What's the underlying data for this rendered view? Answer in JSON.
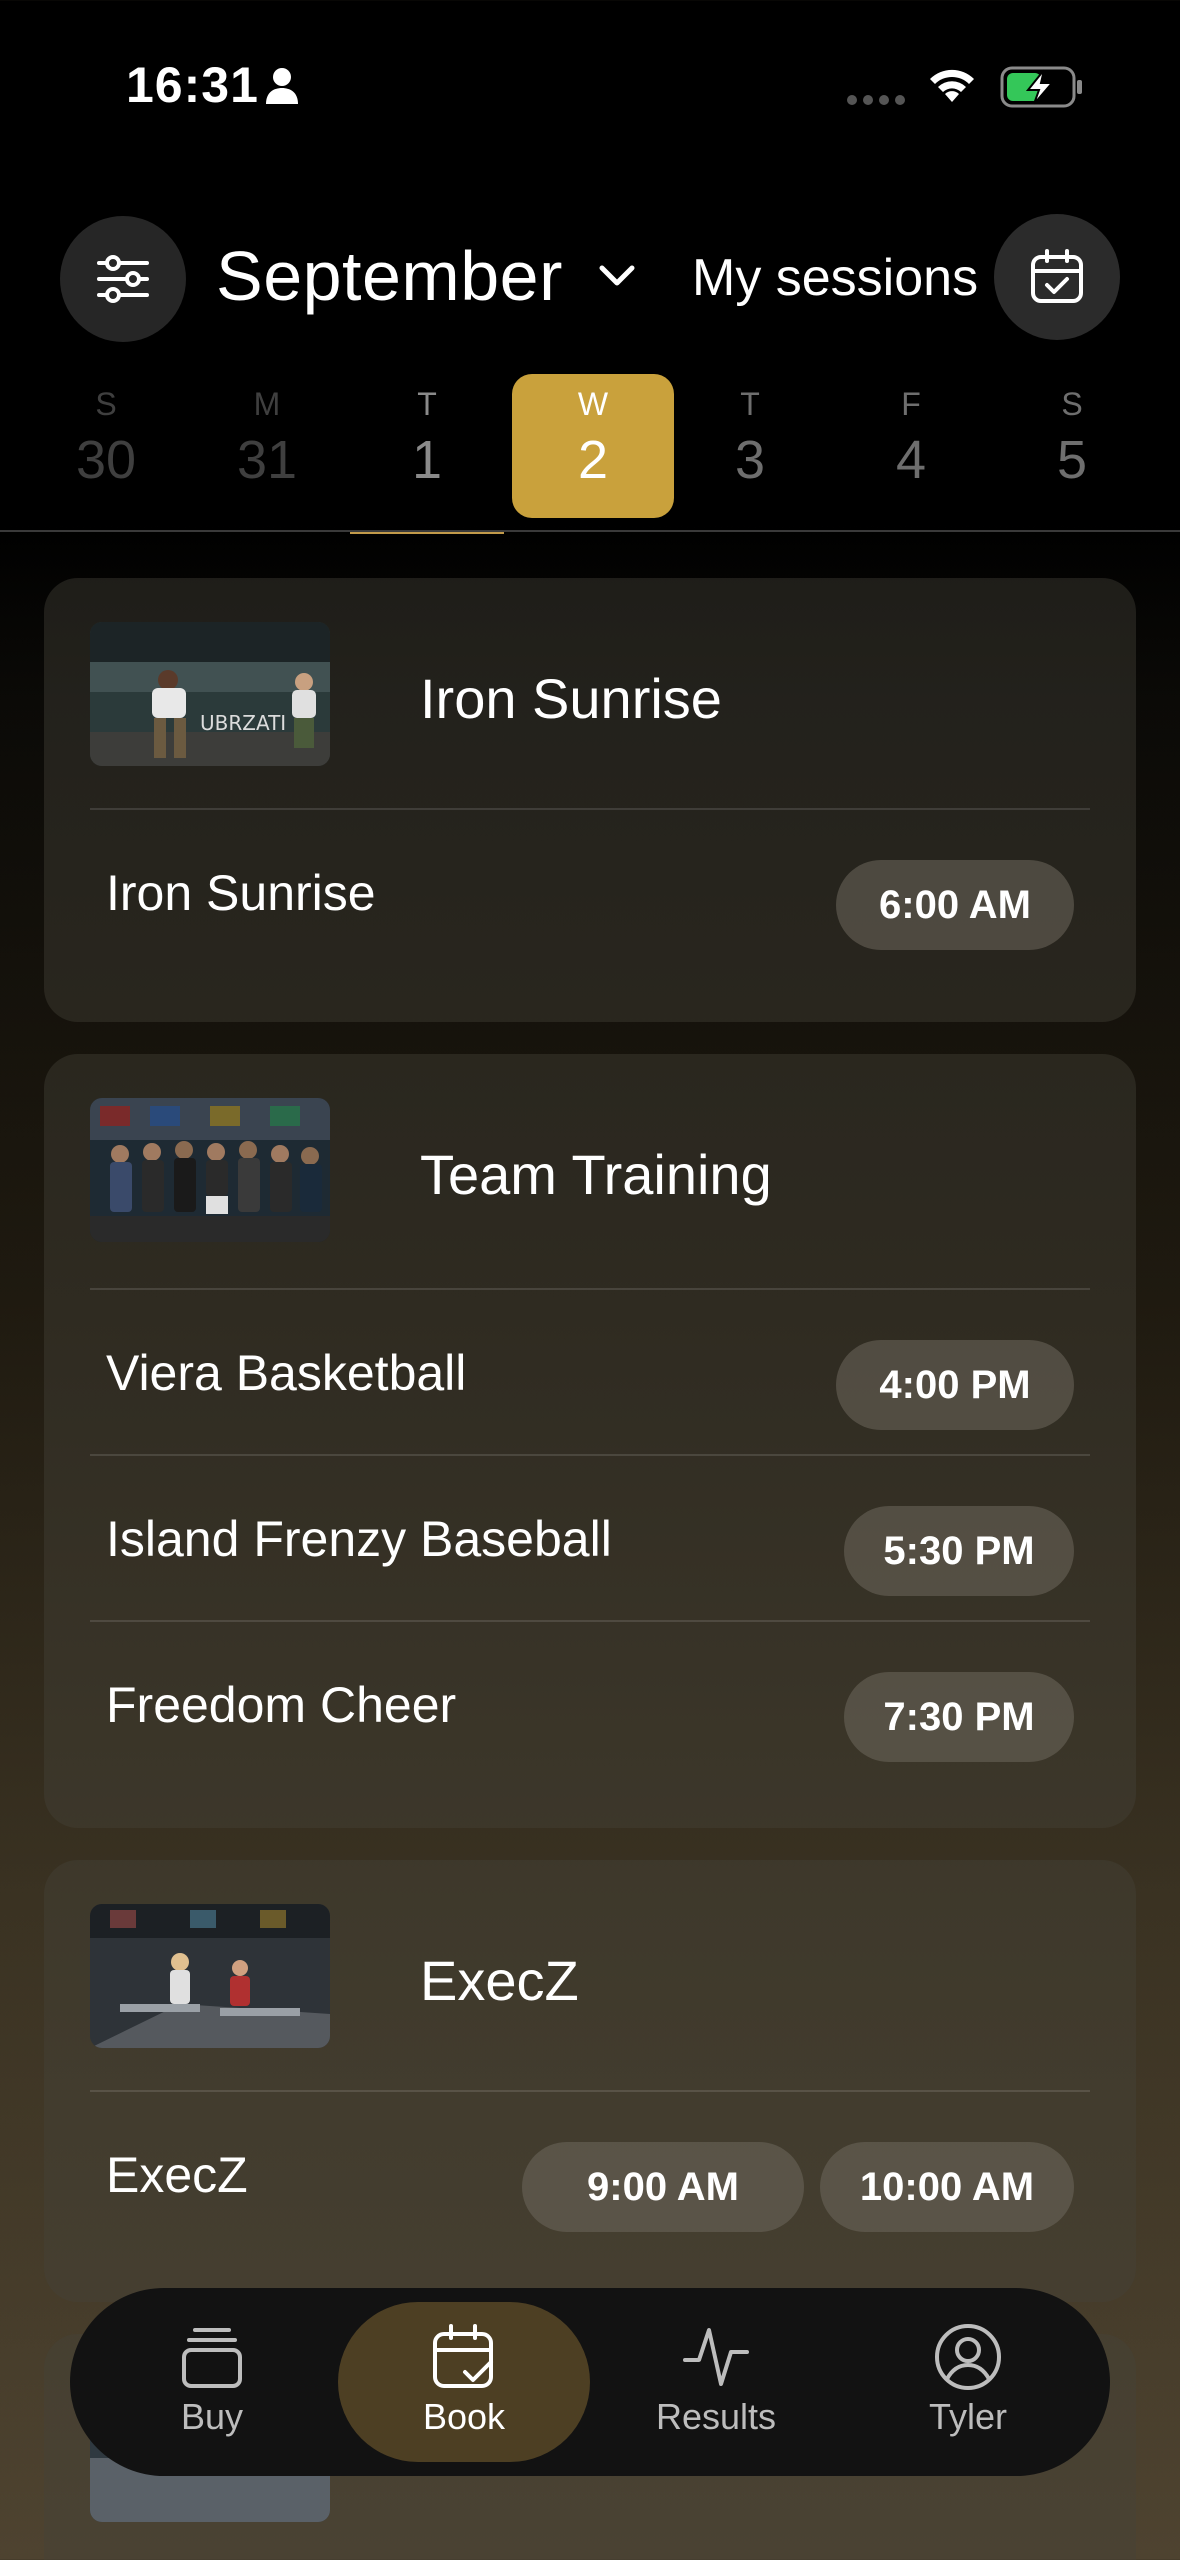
{
  "status_bar": {
    "time": "16:31",
    "icons": [
      "person-icon",
      "signal-dots-icon",
      "wifi-icon",
      "battery-charging-icon"
    ]
  },
  "header": {
    "filter_icon": "sliders-icon",
    "month": "September",
    "month_chevron": "chevron-down-icon",
    "my_sessions": "My sessions",
    "calendar_icon": "calendar-check-icon"
  },
  "days": [
    {
      "letter": "S",
      "number": "30"
    },
    {
      "letter": "M",
      "number": "31"
    },
    {
      "letter": "T",
      "number": "1"
    },
    {
      "letter": "W",
      "number": "2"
    },
    {
      "letter": "T",
      "number": "3"
    },
    {
      "letter": "F",
      "number": "4"
    },
    {
      "letter": "S",
      "number": "5"
    }
  ],
  "selected_day": "2",
  "cards": [
    {
      "title": "Iron Sunrise",
      "rows": [
        {
          "label": "Iron Sunrise",
          "times": [
            "6:00 AM"
          ]
        }
      ]
    },
    {
      "title": "Team Training",
      "rows": [
        {
          "label": "Viera Basketball",
          "times": [
            "4:00 PM"
          ]
        },
        {
          "label": "Island Frenzy Baseball",
          "times": [
            "5:30 PM"
          ]
        },
        {
          "label": "Freedom Cheer",
          "times": [
            "7:30 PM"
          ]
        }
      ]
    },
    {
      "title": "ExecZ",
      "rows": [
        {
          "label": "ExecZ",
          "times": [
            "9:00 AM",
            "10:00 AM"
          ]
        }
      ]
    }
  ],
  "tabbar": {
    "tabs": [
      {
        "label": "Buy",
        "icon": "stack-icon"
      },
      {
        "label": "Book",
        "icon": "calendar-check-icon"
      },
      {
        "label": "Results",
        "icon": "activity-icon"
      },
      {
        "label": "Tyler",
        "icon": "user-circle-icon"
      }
    ],
    "active": "Book"
  },
  "colors": {
    "accent_gold": "#c9a13c",
    "active_tab": "#4d3f23",
    "pill": "#5a554b"
  }
}
